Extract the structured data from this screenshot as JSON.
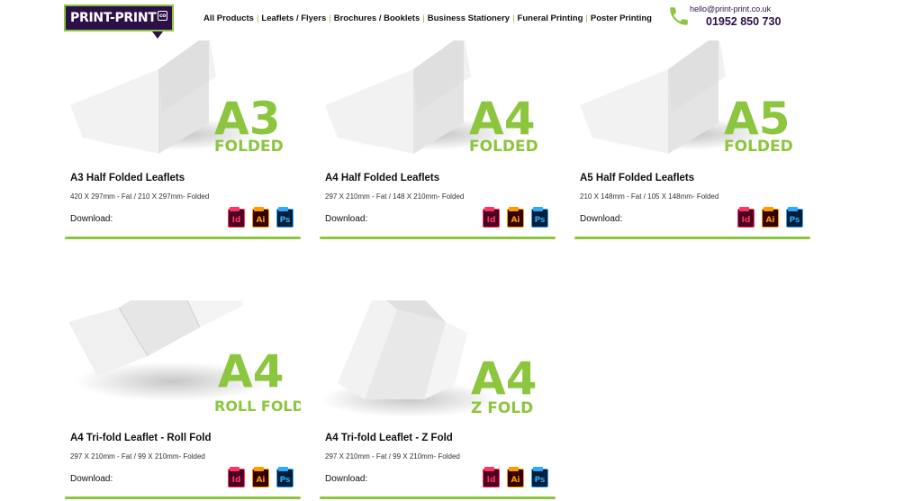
{
  "header": {
    "logo_text": "PRINT-PRINT",
    "logo_badge": "co",
    "nav": [
      "All Products",
      "Leaflets / Flyers",
      "Brochures / Booklets",
      "Business Stationery",
      "Funeral Printing",
      "Poster Printing"
    ],
    "nav_separator": "|",
    "email": "hello@print-print.co.uk",
    "phone": "01952 850 730"
  },
  "colors": {
    "brand_green": "#8cc63f",
    "brand_purple": "#2e1048"
  },
  "icons": {
    "phone": "phone-icon",
    "indesign": "indesign-file-icon",
    "illustrator": "illustrator-file-icon",
    "photoshop": "photoshop-file-icon"
  },
  "cards": [
    {
      "size_text": "A3",
      "fold_text": "FOLDED",
      "title": "A3 Half Folded Leaflets",
      "dims": "420 X 297mm - Fat / 210 X 297mm- Folded",
      "download_label": "Download:",
      "icons": [
        "Id",
        "Ai",
        "Ps"
      ]
    },
    {
      "size_text": "A4",
      "fold_text": "FOLDED",
      "title": "A4 Half Folded Leaflets",
      "dims": "297 X 210mm - Fat / 148 X 210mm- Folded",
      "download_label": "Download:",
      "icons": [
        "Id",
        "Ai",
        "Ps"
      ]
    },
    {
      "size_text": "A5",
      "fold_text": "FOLDED",
      "title": "A5 Half Folded Leaflets",
      "dims": "210 X 148mm - Fat / 105 X 148mm- Folded",
      "download_label": "Download:",
      "icons": [
        "Id",
        "Ai",
        "Ps"
      ]
    },
    {
      "size_text": "A4",
      "fold_text": "ROLL FOLD",
      "title": "A4 Tri-fold Leaflet - Roll Fold",
      "dims": "297 X 210mm - Fat / 99 X 210mm- Folded",
      "download_label": "Download:",
      "icons": [
        "Id",
        "Ai",
        "Ps"
      ]
    },
    {
      "size_text": "A4",
      "fold_text": "Z FOLD",
      "title": "A4 Tri-fold Leaflet - Z Fold",
      "dims": "297 X 210mm - Fat / 99 X 210mm- Folded",
      "download_label": "Download:",
      "icons": [
        "Id",
        "Ai",
        "Ps"
      ]
    }
  ]
}
